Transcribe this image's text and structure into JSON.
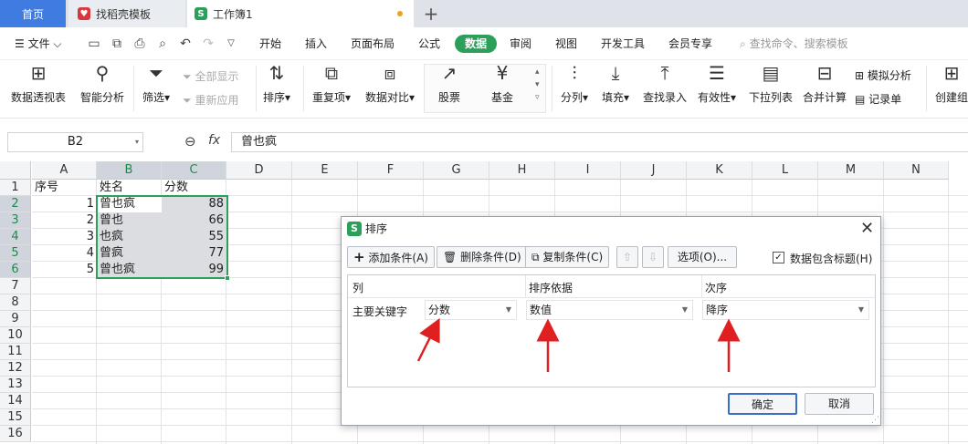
{
  "tabs": {
    "home": "首页",
    "template": "找稻壳模板",
    "workbook": "工作簿1"
  },
  "menu": {
    "file": "文件",
    "items": [
      "开始",
      "插入",
      "页面布局",
      "公式",
      "数据",
      "审阅",
      "视图",
      "开发工具",
      "会员专享"
    ],
    "search": "查找命令、搜索模板"
  },
  "ribbon": {
    "pivot": "数据透视表",
    "smart": "智能分析",
    "filter": "筛选",
    "show_all": "全部显示",
    "reapply": "重新应用",
    "sort": "排序",
    "dup": "重复项",
    "compare": "数据对比",
    "stock": "股票",
    "fund": "基金",
    "split": "分列",
    "fill": "填充",
    "lookup": "查找录入",
    "valid": "有效性",
    "dropdown": "下拉列表",
    "merge": "合并计算",
    "simulate": "模拟分析",
    "record": "记录单",
    "group": "创建组"
  },
  "formula": {
    "cell_ref": "B2",
    "fx": "fx",
    "value": "曾也疯"
  },
  "columns": [
    "A",
    "B",
    "C",
    "D",
    "E",
    "F",
    "G",
    "H",
    "I",
    "J",
    "K",
    "L",
    "M",
    "N"
  ],
  "rows": [
    "1",
    "2",
    "3",
    "4",
    "5",
    "6",
    "7",
    "8",
    "9",
    "10",
    "11",
    "12",
    "13",
    "14",
    "15",
    "16"
  ],
  "sheet": {
    "headers": [
      "序号",
      "姓名",
      "分数"
    ],
    "data": [
      [
        "1",
        "曾也疯",
        "88"
      ],
      [
        "2",
        "曾也",
        "66"
      ],
      [
        "3",
        "也疯",
        "55"
      ],
      [
        "4",
        "曾疯",
        "77"
      ],
      [
        "5",
        "曾也疯",
        "99"
      ]
    ]
  },
  "dialog": {
    "title": "排序",
    "add": "添加条件(A)",
    "delete": "删除条件(D)",
    "copy": "复制条件(C)",
    "options": "选项(O)...",
    "has_header": "数据包含标题(H)",
    "col_header": "列",
    "basis_header": "排序依据",
    "order_header": "次序",
    "primary_key": "主要关键字",
    "key_value": "分数",
    "basis_value": "数值",
    "order_value": "降序",
    "ok": "确定",
    "cancel": "取消"
  },
  "colors": {
    "accent": "#2c9f5b",
    "tab": "#3f7be0",
    "arrow": "#e02020"
  }
}
